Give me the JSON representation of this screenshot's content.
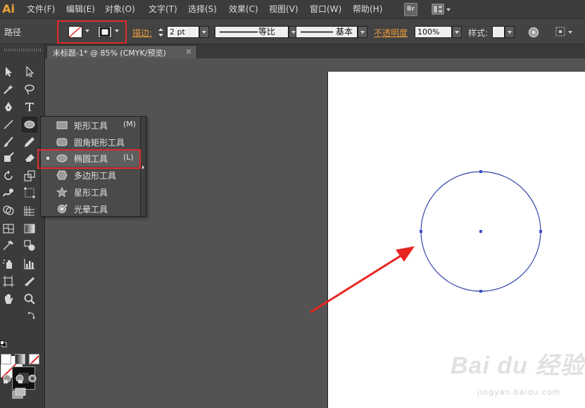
{
  "app": {
    "logo": "Ai"
  },
  "menu": {
    "items": [
      {
        "id": "file",
        "label": "文件(F)"
      },
      {
        "id": "edit",
        "label": "编辑(E)"
      },
      {
        "id": "object",
        "label": "对象(O)"
      },
      {
        "id": "type",
        "label": "文字(T)"
      },
      {
        "id": "select",
        "label": "选择(S)"
      },
      {
        "id": "effect",
        "label": "效果(C)"
      },
      {
        "id": "view",
        "label": "视图(V)"
      },
      {
        "id": "window",
        "label": "窗口(W)"
      },
      {
        "id": "help",
        "label": "帮助(H)"
      }
    ],
    "bridge_label": "Br"
  },
  "control": {
    "selection_label": "路径",
    "stroke_label": "描边:",
    "stroke_weight": "2 pt",
    "profile_label": "等比",
    "brush_label": "基本",
    "opacity_label": "不透明度",
    "opacity_value": "100%",
    "style_label": "样式:"
  },
  "document": {
    "tab_title": "未标题-1* @ 85% (CMYK/预览)",
    "close_glyph": "×"
  },
  "flyout": {
    "items": [
      {
        "label": "矩形工具",
        "shortcut": "(M)",
        "icon": "rectangle-icon"
      },
      {
        "label": "圆角矩形工具",
        "shortcut": "",
        "icon": "rounded-rectangle-icon"
      },
      {
        "label": "椭圆工具",
        "shortcut": "(L)",
        "icon": "ellipse-icon",
        "selected": true
      },
      {
        "label": "多边形工具",
        "shortcut": "",
        "icon": "polygon-icon"
      },
      {
        "label": "星形工具",
        "shortcut": "",
        "icon": "star-icon"
      },
      {
        "label": "光晕工具",
        "shortcut": "",
        "icon": "flare-icon"
      }
    ]
  },
  "colors": {
    "highlight_red": "#e02a2a",
    "path_blue": "#3b4fc9",
    "accent_orange": "#e89a3a"
  },
  "watermark": {
    "brand": "Bai du 经验",
    "domain": "jingyan.baidu.com"
  }
}
